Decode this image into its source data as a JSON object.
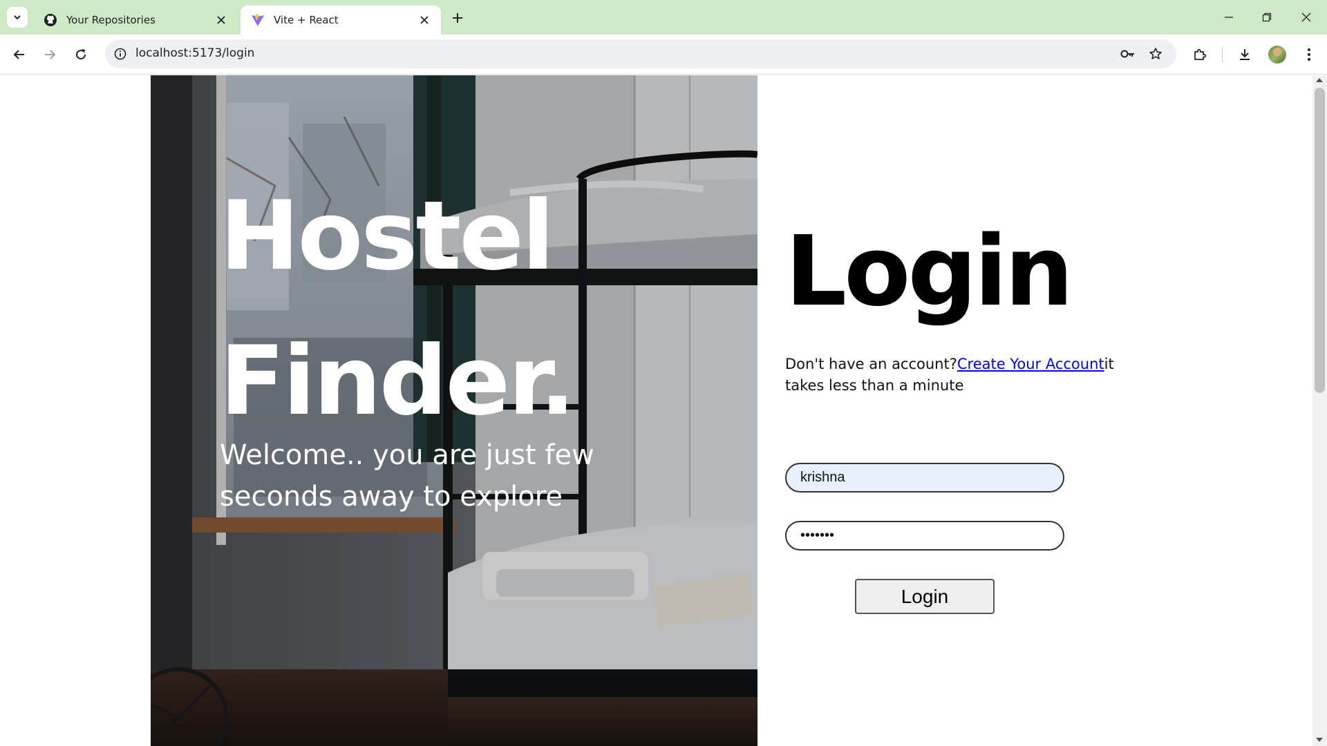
{
  "browser": {
    "tabs": [
      {
        "title": "Your Repositories",
        "favicon": "github-icon",
        "active": false
      },
      {
        "title": "Vite + React",
        "favicon": "vite-icon",
        "active": true
      }
    ],
    "address": "localhost:5173/login"
  },
  "hero": {
    "title": "Hostel\nFinder.",
    "subtitle": "Welcome.. you are just few seconds away to explore"
  },
  "login": {
    "heading": "Login",
    "signup_prefix": "Don't have an account?",
    "signup_link": "Create Your Account",
    "signup_suffix": "it takes less than a minute",
    "username_value": "krishna",
    "password_value": "1234567",
    "button_label": "Login"
  },
  "colors": {
    "tabstrip": "#cde9c5",
    "link": "#0000ee",
    "autofill": "#e8f0fe"
  }
}
